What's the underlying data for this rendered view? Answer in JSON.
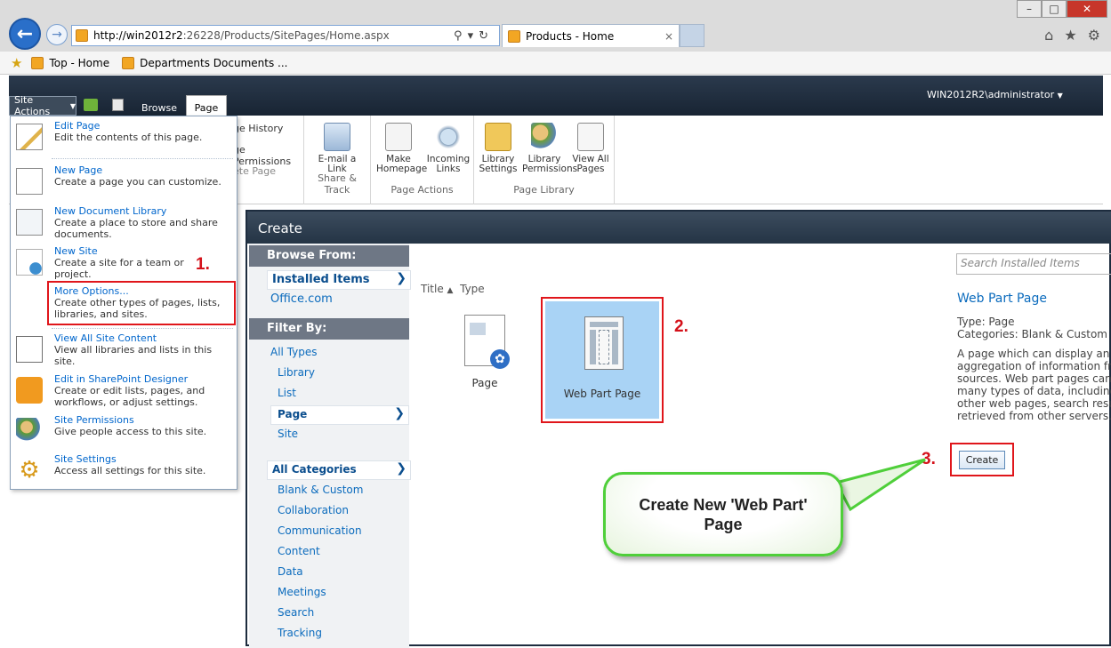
{
  "browser": {
    "url_host": "http://win2012r2",
    "url_rest": ":26228/Products/SitePages/Home.aspx",
    "tab_title": "Products - Home",
    "favorites": [
      "Top - Home",
      "Departments Documents ..."
    ]
  },
  "sharepoint": {
    "site_actions": "Site Actions",
    "tabs": [
      "Browse",
      "Page"
    ],
    "user": "WIN2012R2\\administrator"
  },
  "ribbon": {
    "partial_items": [
      "ge History",
      "ge Permissions",
      "ete Page"
    ],
    "groups": [
      {
        "title": "Share & Track",
        "buttons": [
          "E-mail a Link"
        ]
      },
      {
        "title": "Page Actions",
        "buttons": [
          "Make Homepage",
          "Incoming Links"
        ]
      },
      {
        "title": "Page Library",
        "buttons": [
          "Library Settings",
          "Library Permissions",
          "View All Pages"
        ]
      }
    ]
  },
  "menu": [
    {
      "title": "Edit Page",
      "desc": "Edit the contents of this page."
    },
    {
      "title": "New Page",
      "desc": "Create a page you can customize."
    },
    {
      "title": "New Document Library",
      "desc": "Create a place to store and share documents."
    },
    {
      "title": "New Site",
      "desc": "Create a site for a team or project."
    },
    {
      "title": "More Options...",
      "desc": "Create other types of pages, lists, libraries, and sites."
    },
    {
      "title": "View All Site Content",
      "desc": "View all libraries and lists in this site."
    },
    {
      "title": "Edit in SharePoint Designer",
      "desc": "Create or edit lists, pages, and workflows, or adjust settings."
    },
    {
      "title": "Site Permissions",
      "desc": "Give people access to this site."
    },
    {
      "title": "Site Settings",
      "desc": "Access all settings for this site."
    }
  ],
  "steps": [
    "1.",
    "2.",
    "3."
  ],
  "dialog": {
    "title": "Create",
    "browse_from_header": "Browse From:",
    "installed_items": "Installed Items",
    "office_com": "Office.com",
    "filter_by_header": "Filter By:",
    "types": [
      "All Types",
      "Library",
      "List",
      "Page",
      "Site"
    ],
    "selected_type": "Page",
    "all_categories": "All Categories",
    "categories": [
      "Blank & Custom",
      "Collaboration",
      "Communication",
      "Content",
      "Data",
      "Meetings",
      "Search",
      "Tracking"
    ],
    "sort_title": "Title",
    "sort_type": "Type",
    "items": [
      "Page",
      "Web Part Page"
    ],
    "search_placeholder": "Search Installed Items",
    "detail_title": "Web Part Page",
    "detail_type": "Type: Page",
    "detail_categories": "Categories: Blank & Custom",
    "detail_desc": [
      "A page which can display an",
      "aggregation of information fro",
      "sources. Web part pages can d",
      "many types of data, including",
      "other web pages, search resul",
      "retrieved from other servers."
    ],
    "create_button": "Create"
  },
  "callout": "Create New 'Web Part' Page",
  "colors": {
    "annotation_red": "#e0161b",
    "callout_green": "#4fcf3a",
    "link_blue": "#0b6bbd"
  }
}
